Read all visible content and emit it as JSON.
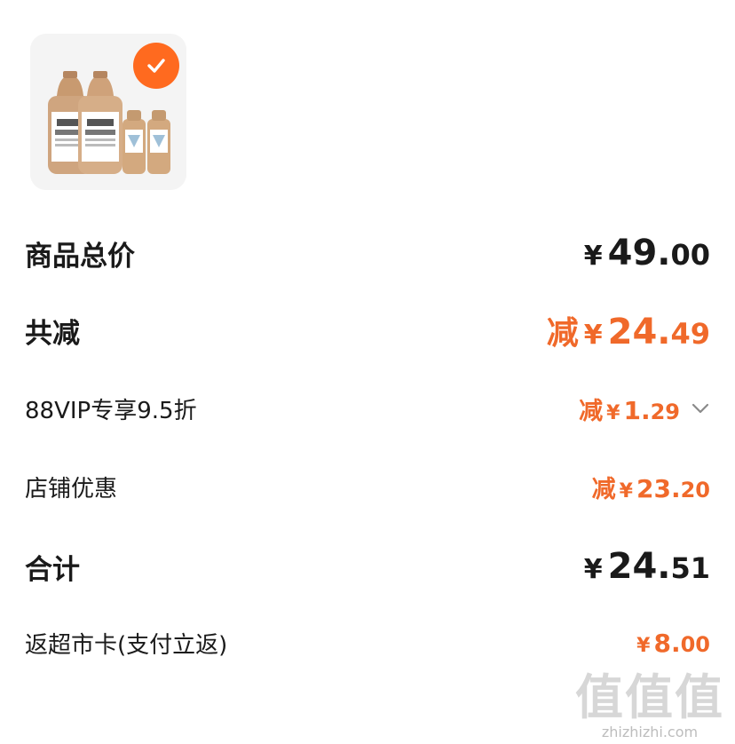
{
  "product": {
    "image_desc": "黑牛 炭烧 酸奶",
    "selected": true
  },
  "rows": {
    "total": {
      "label": "商品总价",
      "yen": "¥",
      "int": "49.",
      "dec": "00"
    },
    "discount": {
      "label": "共减",
      "prefix": "减",
      "yen": "¥",
      "int": "24.",
      "dec": "49"
    },
    "vip": {
      "label": "88VIP专享9.5折",
      "prefix": "减",
      "yen": "¥",
      "int": "1.",
      "dec": "29"
    },
    "shop": {
      "label": "店铺优惠",
      "prefix": "减",
      "yen": "¥",
      "int": "23.",
      "dec": "20"
    },
    "sum": {
      "label": "合计",
      "yen": "¥",
      "int": "24.",
      "dec": "51"
    },
    "card": {
      "label": "返超市卡(支付立返)",
      "yen": "¥",
      "int": "8.",
      "dec": "00"
    }
  },
  "watermark": {
    "logo": "值值值",
    "url": "zhizhizhi.com"
  },
  "colors": {
    "accent": "#f0692a",
    "badge": "#ff6a1f",
    "text": "#1a1a1a"
  },
  "icons": {
    "check": "check-icon",
    "chevron": "chevron-down-icon"
  }
}
